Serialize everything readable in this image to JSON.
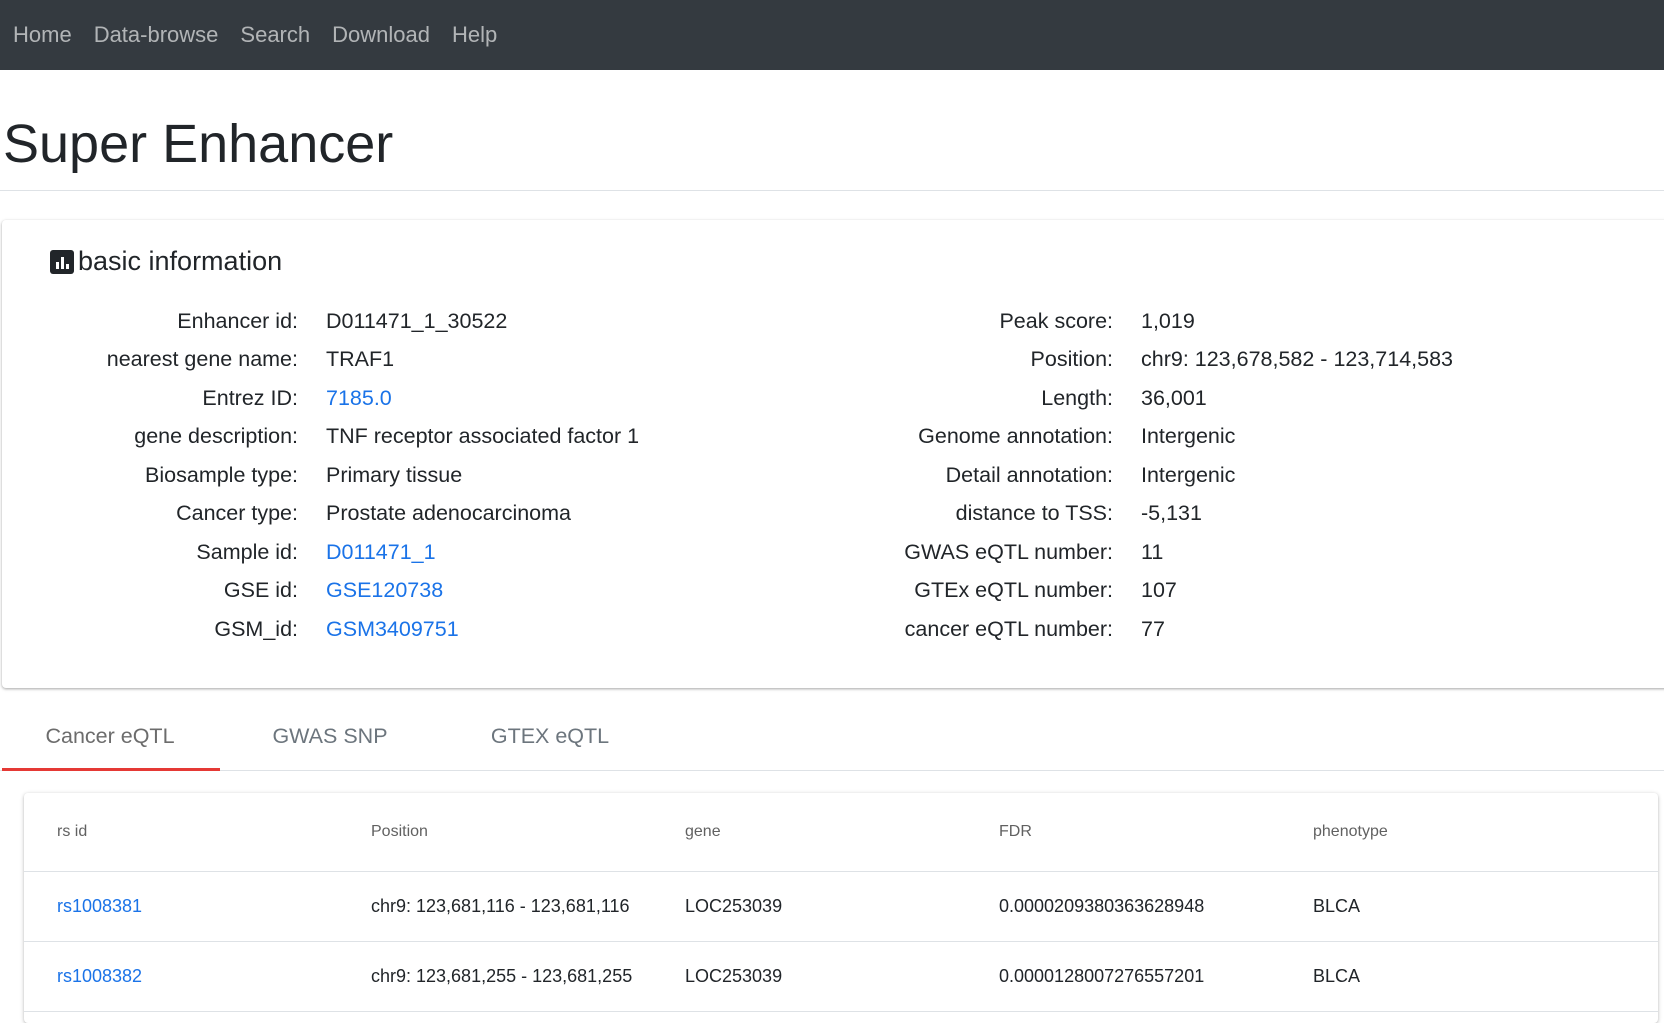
{
  "nav": {
    "items": [
      "Home",
      "Data-browse",
      "Search",
      "Download",
      "Help"
    ]
  },
  "page_title": "Super Enhancer",
  "basic_info": {
    "title": "basic information",
    "icon": "bar-chart-icon",
    "left": [
      {
        "label": "Enhancer id:",
        "value": "D011471_1_30522",
        "link": false
      },
      {
        "label": "nearest gene name:",
        "value": "TRAF1",
        "link": false
      },
      {
        "label": "Entrez ID:",
        "value": "7185.0",
        "link": true
      },
      {
        "label": "gene description:",
        "value": "TNF receptor associated factor 1",
        "link": false
      },
      {
        "label": "Biosample type:",
        "value": "Primary tissue",
        "link": false
      },
      {
        "label": "Cancer type:",
        "value": "Prostate adenocarcinoma",
        "link": false
      },
      {
        "label": "Sample id:",
        "value": "D011471_1",
        "link": true
      },
      {
        "label": "GSE id:",
        "value": "GSE120738",
        "link": true
      },
      {
        "label": "GSM_id:",
        "value": "GSM3409751",
        "link": true
      }
    ],
    "right": [
      {
        "label": "Peak score:",
        "value": "1,019"
      },
      {
        "label": "Position:",
        "value": "chr9: 123,678,582 - 123,714,583"
      },
      {
        "label": "Length:",
        "value": "36,001"
      },
      {
        "label": "Genome annotation:",
        "value": "Intergenic"
      },
      {
        "label": "Detail annotation:",
        "value": "Intergenic"
      },
      {
        "label": "distance to TSS:",
        "value": "-5,131"
      },
      {
        "label": "GWAS eQTL number:",
        "value": "11"
      },
      {
        "label": "GTEx eQTL number:",
        "value": "107"
      },
      {
        "label": "cancer eQTL number:",
        "value": "77"
      }
    ]
  },
  "tabs": [
    "Cancer eQTL",
    "GWAS SNP",
    "GTEX eQTL"
  ],
  "active_tab": 0,
  "table": {
    "headers": [
      "rs id",
      "Position",
      "gene",
      "FDR",
      "phenotype"
    ],
    "rows": [
      [
        "rs1008381",
        "chr9: 123,681,116 - 123,681,116",
        "LOC253039",
        "0.0000209380363628948",
        "BLCA"
      ],
      [
        "rs1008382",
        "chr9: 123,681,255 - 123,681,255",
        "LOC253039",
        "0.0000128007276557201",
        "BLCA"
      ]
    ]
  },
  "colors": {
    "navbar": "#343a40",
    "link": "#1a73e8",
    "tab_indicator": "#e53935"
  }
}
